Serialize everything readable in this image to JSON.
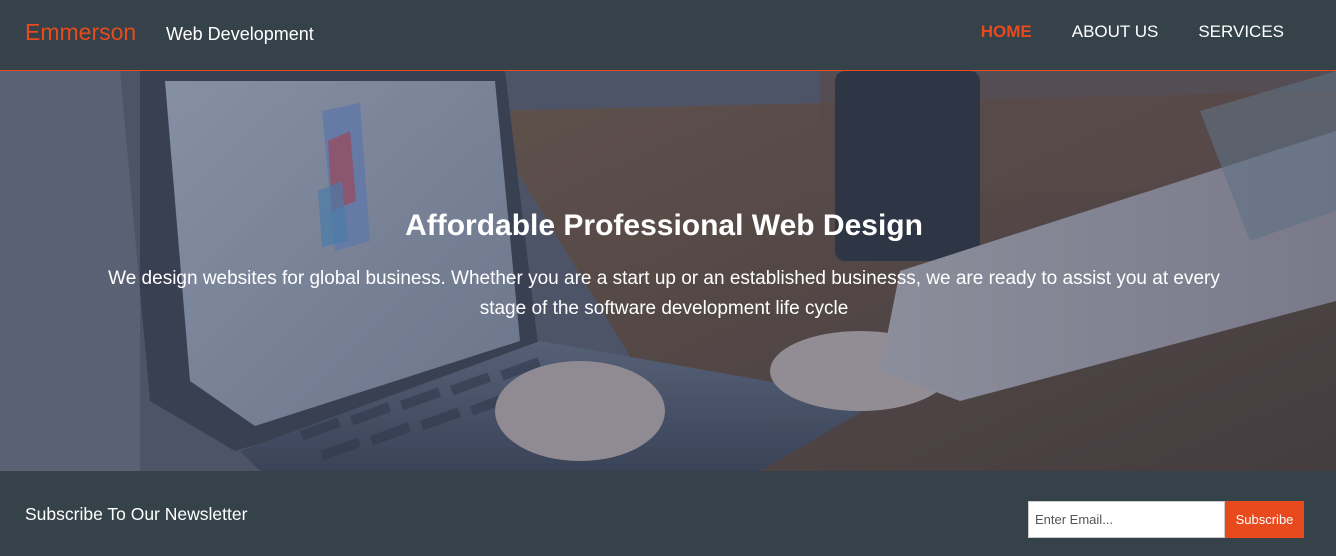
{
  "header": {
    "brand": "Emmerson",
    "tagline": "Web Development",
    "nav": [
      {
        "label": "HOME",
        "active": true
      },
      {
        "label": "ABOUT US",
        "active": false
      },
      {
        "label": "SERVICES",
        "active": false
      }
    ]
  },
  "hero": {
    "title": "Affordable Professional Web Design",
    "text": "We design websites for global business. Whether you are a start up or an established businesss, we are ready to assist you at every stage of the software development life cycle"
  },
  "newsletter": {
    "title": "Subscribe To Our Newsletter",
    "email_placeholder": "Enter Email...",
    "email_value": "",
    "button_label": "Subscribe"
  },
  "colors": {
    "accent": "#e8491d",
    "dark": "#35424a",
    "text": "#ffffff"
  }
}
